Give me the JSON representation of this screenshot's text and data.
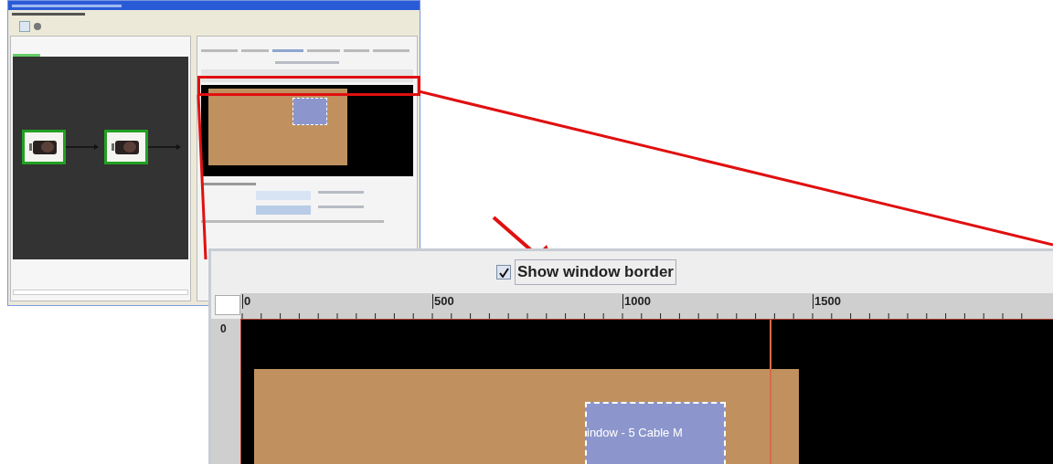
{
  "callout": {
    "checkbox": {
      "label": "Show window border",
      "checked": true
    },
    "ruler": {
      "x_labels": [
        "0",
        "500",
        "1000",
        "1500"
      ],
      "y_labels": [
        "0"
      ]
    },
    "canvas": {
      "window_label": "indow - 5 Cable M"
    }
  }
}
